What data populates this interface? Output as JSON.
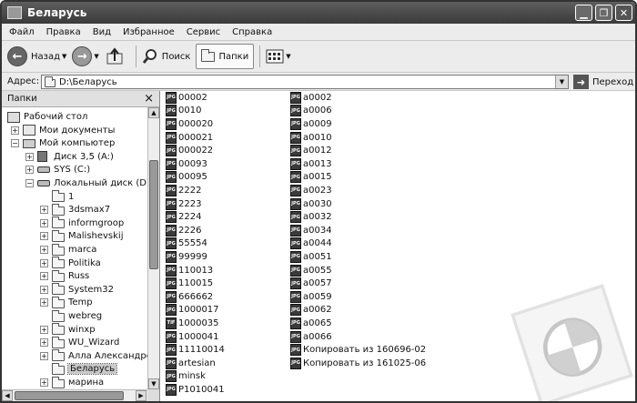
{
  "window": {
    "title": "Беларусь"
  },
  "menu": [
    "Файл",
    "Правка",
    "Вид",
    "Избранное",
    "Сервис",
    "Справка"
  ],
  "toolbar": {
    "back_label": "Назад",
    "search_label": "Поиск",
    "folders_label": "Папки"
  },
  "address": {
    "label": "Адрес:",
    "value": "D:\\Беларусь",
    "go_label": "Переход"
  },
  "folders_pane": {
    "title": "Папки"
  },
  "tree": [
    {
      "label": "Рабочий стол",
      "level": 0,
      "icon": "desktop-icon",
      "expander": "none"
    },
    {
      "label": "Мои документы",
      "level": 1,
      "icon": "documents-icon",
      "expander": "plus"
    },
    {
      "label": "Мой компьютер",
      "level": 1,
      "icon": "computer-icon",
      "expander": "minus"
    },
    {
      "label": "Диск 3,5 (A:)",
      "level": 2,
      "icon": "floppy-icon",
      "expander": "plus"
    },
    {
      "label": "SYS (C:)",
      "level": 2,
      "icon": "drive-icon",
      "expander": "plus"
    },
    {
      "label": "Локальный диск (D:)",
      "level": 2,
      "icon": "drive-icon",
      "expander": "minus"
    },
    {
      "label": "1",
      "level": 3,
      "icon": "folder-icon",
      "expander": "none"
    },
    {
      "label": "3dsmax7",
      "level": 3,
      "icon": "folder-icon",
      "expander": "plus"
    },
    {
      "label": "informgroop",
      "level": 3,
      "icon": "folder-icon",
      "expander": "plus"
    },
    {
      "label": "Malishevskij",
      "level": 3,
      "icon": "folder-icon",
      "expander": "plus"
    },
    {
      "label": "marca",
      "level": 3,
      "icon": "folder-icon",
      "expander": "plus"
    },
    {
      "label": "Politika",
      "level": 3,
      "icon": "folder-icon",
      "expander": "plus"
    },
    {
      "label": "Russ",
      "level": 3,
      "icon": "folder-icon",
      "expander": "plus"
    },
    {
      "label": "System32",
      "level": 3,
      "icon": "folder-icon",
      "expander": "plus"
    },
    {
      "label": "Temp",
      "level": 3,
      "icon": "folder-icon",
      "expander": "plus"
    },
    {
      "label": "webreg",
      "level": 3,
      "icon": "folder-icon",
      "expander": "none"
    },
    {
      "label": "winxp",
      "level": 3,
      "icon": "folder-icon",
      "expander": "plus"
    },
    {
      "label": "WU_Wizard",
      "level": 3,
      "icon": "folder-icon",
      "expander": "plus"
    },
    {
      "label": "Алла Александровна",
      "level": 3,
      "icon": "folder-icon",
      "expander": "plus"
    },
    {
      "label": "Беларусь",
      "level": 3,
      "icon": "folder-open-icon",
      "expander": "none",
      "selected": true
    },
    {
      "label": "марина",
      "level": 3,
      "icon": "folder-icon",
      "expander": "plus"
    }
  ],
  "files_col1": [
    "00002",
    "0010",
    "000020",
    "000021",
    "000022",
    "00093",
    "00095",
    "2222",
    "2223",
    "2224",
    "2226",
    "55554",
    "99999",
    "110013",
    "110015",
    "666662",
    "1000017",
    "1000035",
    "1000041",
    "11110014",
    "artesian",
    "minsk",
    "P1010041"
  ],
  "files_col2": [
    "a0002",
    "a0006",
    "a0009",
    "a0010",
    "a0012",
    "a0013",
    "a0015",
    "a0023",
    "a0030",
    "a0032",
    "a0034",
    "a0044",
    "a0051",
    "a0055",
    "a0057",
    "a0059",
    "a0062",
    "a0065",
    "a0066",
    "Копировать из 160696-02",
    "Копировать из 161025-06"
  ],
  "file_icon_text": "JPG",
  "file_icon_text_alt": "TIF"
}
